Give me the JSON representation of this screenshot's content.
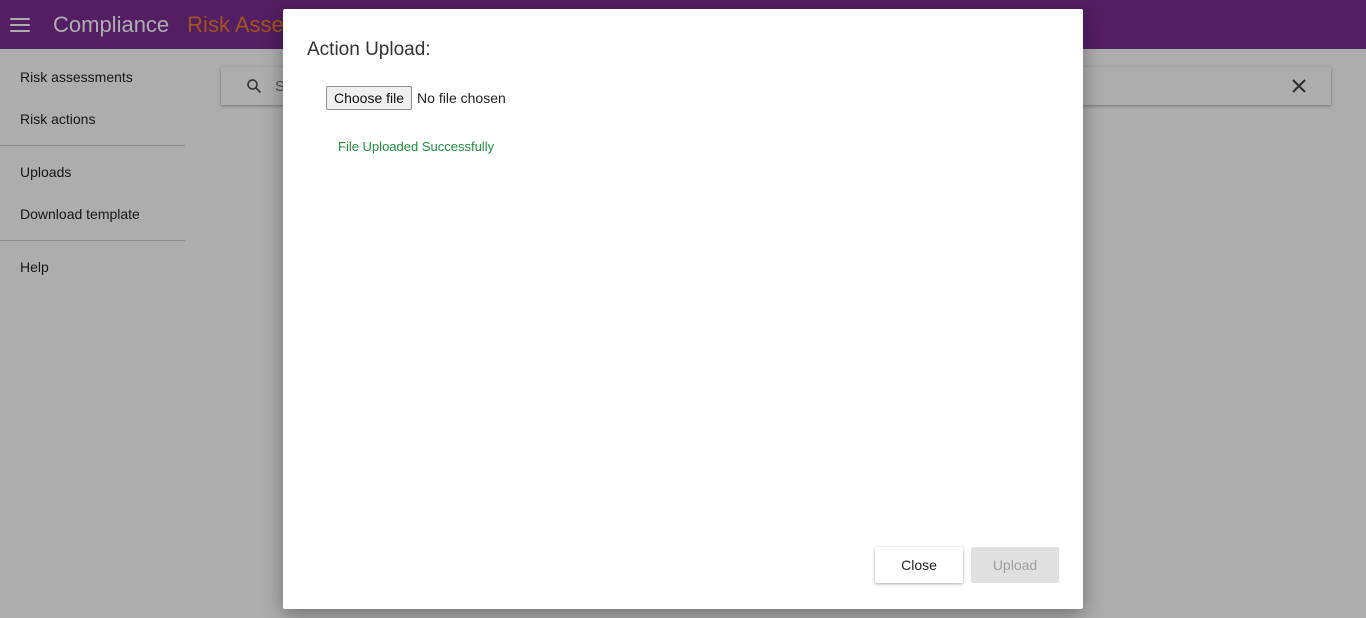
{
  "colors": {
    "topbar": "#7b2d93",
    "accent_orange": "#f07d25",
    "success_green": "#1e8e3e"
  },
  "header": {
    "menu_icon": "hamburger-menu-icon",
    "app_title": "Compliance",
    "section_title": "Risk Asses"
  },
  "sidebar": {
    "items": [
      {
        "label": "Risk assessments"
      },
      {
        "label": "Risk actions"
      },
      {
        "label": "Uploads"
      },
      {
        "label": "Download template"
      },
      {
        "label": "Help"
      }
    ]
  },
  "search": {
    "icon": "search-icon",
    "placeholder": "S",
    "clear_icon": "close-icon"
  },
  "dialog": {
    "title": "Action Upload:",
    "choose_file_label": "Choose file",
    "file_status": "No file chosen",
    "success_message": "File Uploaded Successfully",
    "close_label": "Close",
    "upload_label": "Upload"
  }
}
